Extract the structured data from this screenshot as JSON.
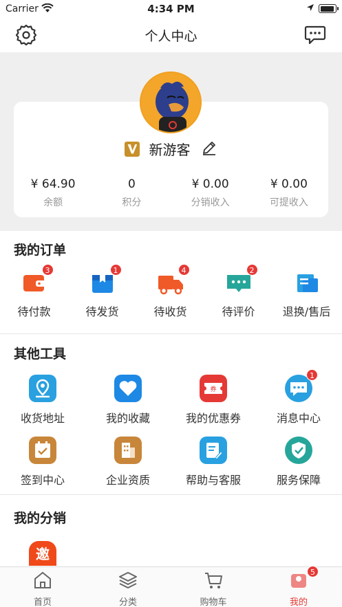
{
  "status_bar": {
    "carrier": "Carrier",
    "time": "4:34 PM"
  },
  "nav": {
    "title": "个人中心",
    "settings_icon": "gear-icon",
    "message_icon": "chat-icon"
  },
  "profile": {
    "username": "新游客",
    "stats": [
      {
        "value": "¥ 64.90",
        "label": "余额"
      },
      {
        "value": "0",
        "label": "积分"
      },
      {
        "value": "¥ 0.00",
        "label": "分销收入"
      },
      {
        "value": "¥ 0.00",
        "label": "可提收入"
      }
    ]
  },
  "orders": {
    "title": "我的订单",
    "items": [
      {
        "label": "待付款",
        "badge": "3",
        "icon": "wallet-icon",
        "color": "#f05a28"
      },
      {
        "label": "待发货",
        "badge": "1",
        "icon": "package-icon",
        "color": "#1e88e5"
      },
      {
        "label": "待收货",
        "badge": "4",
        "icon": "truck-icon",
        "color": "#f05a28"
      },
      {
        "label": "待评价",
        "badge": "2",
        "icon": "comment-icon",
        "color": "#26a69a"
      },
      {
        "label": "退换/售后",
        "badge": "",
        "icon": "return-icon",
        "color": "#29a0e0"
      }
    ]
  },
  "tools": {
    "title": "其他工具",
    "items": [
      {
        "label": "收货地址",
        "badge": "",
        "icon": "location-icon",
        "color": "#29a0e0"
      },
      {
        "label": "我的收藏",
        "badge": "",
        "icon": "heart-icon",
        "color": "#1e88e5"
      },
      {
        "label": "我的优惠券",
        "badge": "",
        "icon": "coupon-icon",
        "color": "#e53935"
      },
      {
        "label": "消息中心",
        "badge": "1",
        "icon": "message-icon",
        "color": "#29a0e0"
      },
      {
        "label": "签到中心",
        "badge": "",
        "icon": "calendar-check-icon",
        "color": "#c8863a"
      },
      {
        "label": "企业资质",
        "badge": "",
        "icon": "building-icon",
        "color": "#c8863a"
      },
      {
        "label": "帮助与客服",
        "badge": "",
        "icon": "help-icon",
        "color": "#29a0e0"
      },
      {
        "label": "服务保障",
        "badge": "",
        "icon": "shield-icon",
        "color": "#26a69a"
      }
    ]
  },
  "distribution": {
    "title": "我的分销",
    "invite_char": "邀"
  },
  "tab_bar": {
    "items": [
      {
        "label": "首页",
        "icon": "home-icon"
      },
      {
        "label": "分类",
        "icon": "layers-icon"
      },
      {
        "label": "购物车",
        "icon": "cart-icon"
      },
      {
        "label": "我的",
        "icon": "user-icon",
        "badge": "5"
      }
    ]
  }
}
